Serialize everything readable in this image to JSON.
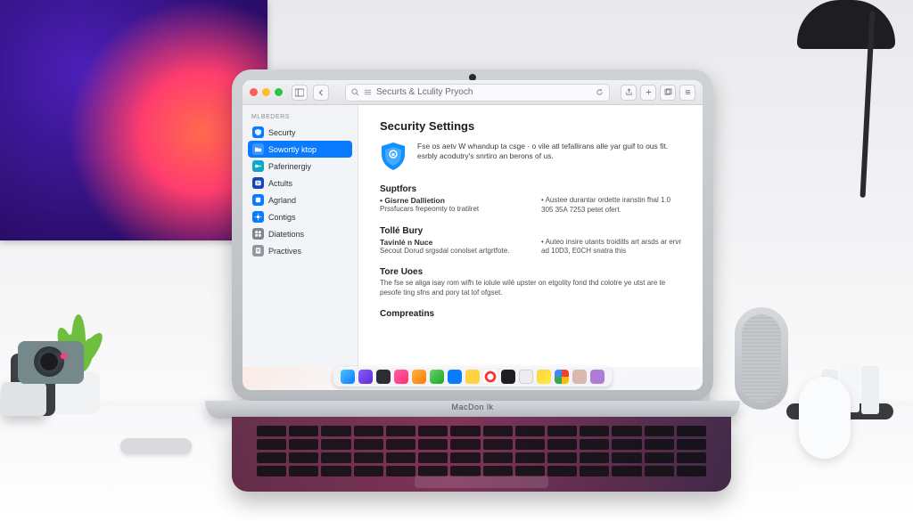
{
  "toolbar": {
    "address_text": "Securts & Lculity Pryoch",
    "search_icon": "search-icon",
    "reload_icon": "reload-icon",
    "back_icon": "chevron-left-icon",
    "sidebar_toggle_icon": "sidebar-toggle-icon"
  },
  "sidebar": {
    "section_label": "Mlbeders",
    "items": [
      {
        "icon": "shield-icon",
        "label": "Securty"
      },
      {
        "icon": "folder-icon",
        "label": "Sowortly ktop"
      },
      {
        "icon": "key-icon",
        "label": "Paferinergiy"
      },
      {
        "icon": "badge-icon",
        "label": "Actults"
      },
      {
        "icon": "app-icon",
        "label": "Agrland"
      },
      {
        "icon": "gear-icon",
        "label": "Contigs"
      },
      {
        "icon": "grid-icon",
        "label": "Diatetions"
      },
      {
        "icon": "doc-icon",
        "label": "Practives"
      }
    ],
    "active_index": 1
  },
  "page": {
    "title": "Security Settings",
    "intro": "Fse os aetv W whandup ta csge · o vile atl tefallirans alle yar guif to ous fit. esrbly acodutry's snrtiro an berons of us.",
    "sections": [
      {
        "heading": "Suptfors",
        "subhead": "• Gisrne Dallietion",
        "left": "Prssfucars frepeomty to tratilret",
        "right": "• Austee durantar ordette iranstin fhal 1.0 305 35A 7253 petet ofert."
      },
      {
        "heading": "Tollé Bury",
        "subhead": "Tavinlé n Nuce",
        "left": "Secout Dorud srgsdal conolset artgrtfote.",
        "right": "• Auteo insire utants troiditls art arsds ar ervr ad 10D3, E0CH snatra this"
      },
      {
        "heading": "Tore Uoes",
        "body": "The fse se aliga isay rom wifh te iolule wilé upster on etgolity fond thd colotre ye utst are te pesofe ting sfns and pory tat lof ofgset."
      },
      {
        "heading": "Compreatins"
      }
    ]
  },
  "dock": {
    "apps": [
      "finder",
      "launchpad",
      "terminal",
      "music",
      "maps",
      "messages",
      "safari",
      "notes",
      "target",
      "ide",
      "files",
      "preview",
      "chrome",
      "photos",
      "settings"
    ]
  },
  "device": {
    "brand": "MacDon lk"
  }
}
